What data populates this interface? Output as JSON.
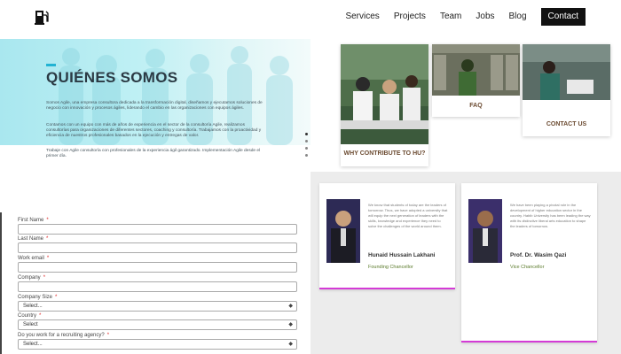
{
  "nav": {
    "items": [
      "Services",
      "Projects",
      "Team",
      "Jobs",
      "Blog"
    ],
    "contact_label": "Contact"
  },
  "about": {
    "title": "QUIÉNES SOMOS",
    "p1": "Somos Agile, una empresa consultora dedicada a la transformación digital, diseñamos y ejecutamos soluciones de negocio con innovación y procesos ágiles, liderando el cambio en las organizaciones con equipos ágiles.",
    "p2": "Contamos con un equipo con más de años de experiencia en el sector de la consultoría Agile, realizamos consultorías para organizaciones de diferentes sectores, coaching y consultoría. Trabajamos con la proactividad y eficiencia de nuestros profesionales basados en la ejecución y entregas de valor.",
    "p3": "Trabaje con Agile consultoría con profesionales de la experiencia ágil garantizado. Implementación Agile desde el primer día."
  },
  "tiles": [
    {
      "caption": "WHY CONTRIBUTE TO HU?"
    },
    {
      "caption": "FAQ"
    },
    {
      "caption": "CONTACT US"
    }
  ],
  "testimonials": [
    {
      "quote": "We know that students of today are the leaders of tomorrow. Thus, we have adopted a university that will equip the next generation of leaders with the skills, knowledge and experience they need to solve the challenges of the world around them.",
      "name": "Hunaid Hussain Lakhani",
      "role": "Founding Chancellor"
    },
    {
      "quote": "We have been playing a pivotal role in the development of higher education sector in the country. Habib University has been leading the way with its distinctive liberal arts education to shape the leaders of tomorrow.",
      "name": "Prof. Dr. Wasim Qazi",
      "role": "Vice Chancellor"
    }
  ],
  "form": {
    "first_name_label": "First Name",
    "last_name_label": "Last Name",
    "work_email_label": "Work email",
    "company_label": "Company",
    "company_size_label": "Company Size",
    "company_size_value": "Select...",
    "country_label": "Country",
    "country_value": "Select",
    "recruiting_label": "Do you work for a recruiting agency?",
    "recruiting_value": "Select...",
    "required_mark": "*"
  },
  "colors": {
    "accent": "#22b3d3",
    "card_border": "#d43bd6",
    "tile_caption": "#6b4a30",
    "role_text": "#5a7a2a"
  },
  "icons": {
    "logo": "fuel-pump-icon",
    "select_arrow": "up-down-arrow-icon"
  }
}
